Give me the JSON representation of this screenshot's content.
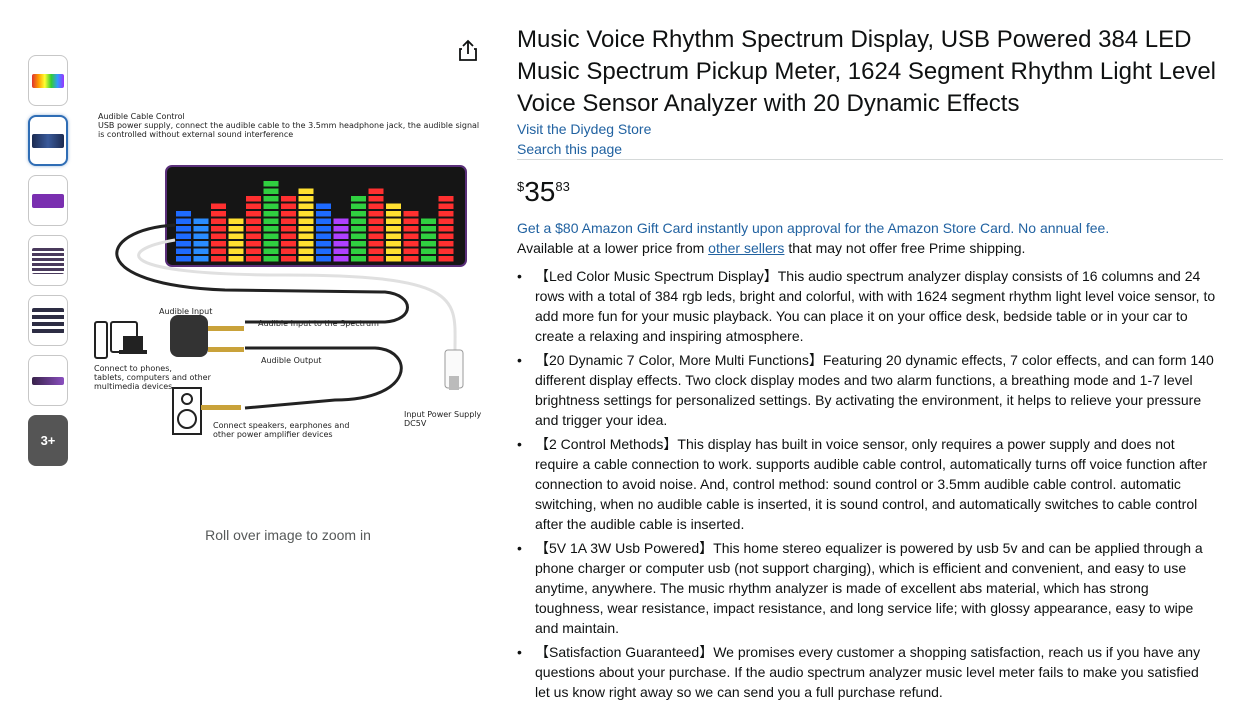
{
  "product": {
    "title": "Music Voice Rhythm Spectrum Display, USB Powered 384 LED Music Spectrum Pickup Meter, 1624 Segment Rhythm Light Level Voice Sensor Analyzer with 20 Dynamic Effects",
    "store_link": "Visit the Diydeg Store",
    "search_link": "Search this page"
  },
  "price": {
    "symbol": "$",
    "whole": "35",
    "fraction": "83"
  },
  "offers": {
    "gift_card": "Get a $80 Amazon Gift Card instantly upon approval for the Amazon Store Card. No annual fee.",
    "lower_price_prefix": "Available at a lower price from ",
    "lower_price_link": "other sellers",
    "lower_price_suffix": " that may not offer free Prime shipping."
  },
  "gallery": {
    "zoom_hint": "Roll over image to zoom in",
    "more_label": "3+",
    "thumb_colors": [
      "#3a1f6e",
      "#1b2a50",
      "#7a2fb0",
      "#4a3a5c",
      "#2d2d44",
      "#38224a"
    ],
    "diagram": {
      "header_title": "Audible Cable Control",
      "header_line1": "USB power supply, connect the audible cable to the 3.5mm headphone jack, the audible signal",
      "header_line2": "is controlled without external sound interference",
      "audible_input": "Audible Input",
      "input_to_spectrum": "Audible Input to the Spectrum",
      "audible_output": "Audible Output",
      "connect_phones_1": "Connect to phones,",
      "connect_phones_2": "tablets, computers and other",
      "connect_phones_3": "multimedia devices",
      "input_power_1": "Input Power Supply",
      "input_power_2": "DC5V",
      "speakers_1": "Connect speakers, earphones and",
      "speakers_2": "other power amplifier devices"
    }
  },
  "bullets": [
    "【Led Color Music Spectrum Display】This audio spectrum analyzer display consists of 16 columns and 24 rows with a total of 384 rgb leds, bright and colorful, with with 1624 segment rhythm light level voice sensor, to add more fun for your music playback. You can place it on your office desk, bedside table or in your car to create a relaxing and inspiring atmosphere.",
    "【20 Dynamic 7 Color, More Multi Functions】Featuring 20 dynamic effects, 7 color effects, and can form 140 different display effects. Two clock display modes and two alarm functions, a breathing mode and 1-7 level brightness settings for personalized settings. By activating the environment, it helps to relieve your pressure and trigger your idea.",
    "【2 Control Methods】This display has built in voice sensor, only requires a power supply and does not require a cable connection to work. supports audible cable control, automatically turns off voice function after connection to avoid noise. And, control method: sound control or 3.5mm audible cable control. automatic switching, when no audible cable is inserted, it is sound control, and automatically switches to cable control after the audible cable is inserted.",
    "【5V 1A 3W Usb Powered】This home stereo equalizer is powered by usb 5v and can be applied through a phone charger or computer usb (not support charging), which is efficient and convenient, and easy to use anytime, anywhere. The music rhythm analyzer is made of excellent abs material, which has strong toughness, wear resistance, impact resistance, and long service life; with glossy appearance, easy to wipe and maintain.",
    "【Satisfaction Guaranteed】We promises every customer a shopping satisfaction, reach us if you have any questions about your purchase. If the audio spectrum analyzer music level meter fails to make you satisfied let us know right away so we can send you a full purchase refund."
  ]
}
